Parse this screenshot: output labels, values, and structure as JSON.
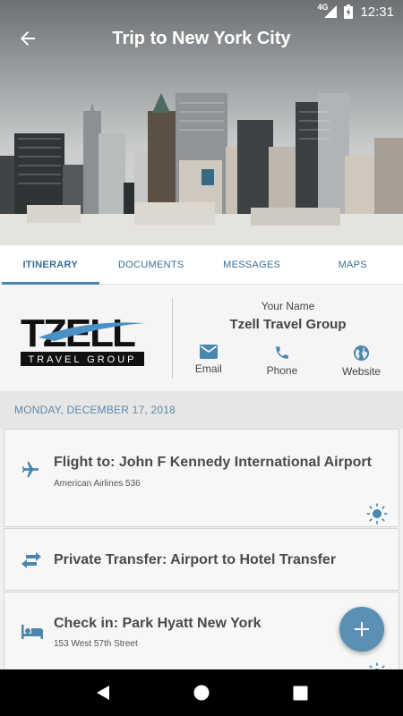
{
  "status_bar": {
    "network": "4G",
    "time": "12:31"
  },
  "header": {
    "title": "Trip to New York City"
  },
  "tabs": [
    {
      "label": "ITINERARY",
      "active": true
    },
    {
      "label": "DOCUMENTS",
      "active": false
    },
    {
      "label": "MESSAGES",
      "active": false
    },
    {
      "label": "MAPS",
      "active": false
    }
  ],
  "agency": {
    "logo_text": "TZELL",
    "logo_tagline": "TRAVEL GROUP",
    "agent_name": "Your Name",
    "agency_name": "Tzell Travel Group",
    "contacts": [
      {
        "label": "Email",
        "icon": "email-icon"
      },
      {
        "label": "Phone",
        "icon": "phone-icon"
      },
      {
        "label": "Website",
        "icon": "globe-icon"
      }
    ]
  },
  "itinerary": {
    "date": "MONDAY, DECEMBER 17, 2018",
    "items": [
      {
        "icon": "airplane-icon",
        "title": "Flight to: John F Kennedy International Airport",
        "subtitle": "American Airlines 536",
        "weather_icon": "sun-icon"
      },
      {
        "icon": "transfer-arrows-icon",
        "title": "Private Transfer: Airport to Hotel Transfer"
      },
      {
        "icon": "bed-icon",
        "title": "Check in: Park Hyatt New York",
        "subtitle": "153 West 57th Street",
        "weather_icon": "sun-icon"
      }
    ]
  },
  "fab": {
    "label": "+",
    "icon": "plus-icon"
  },
  "colors": {
    "accent": "#4b86ad",
    "fab": "#5b8fb3",
    "date_text": "#5d8aab"
  }
}
